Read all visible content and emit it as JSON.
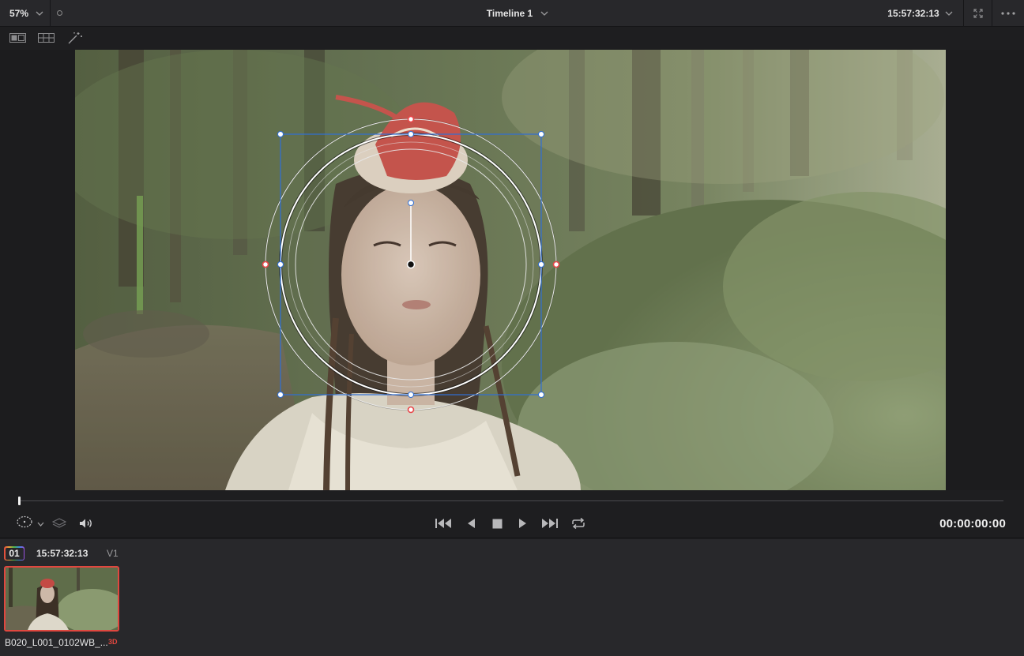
{
  "viewer": {
    "zoom": "57%",
    "timeline_name": "Timeline 1",
    "source_timecode": "15:57:32:13",
    "playhead_position": 0.0,
    "record_timecode": "00:00:00:00"
  },
  "icons": {
    "zoom_dropdown": "chevron-down-icon",
    "dot": "circle-dot-icon",
    "timeline_dropdown": "chevron-down-icon",
    "timecode_dropdown": "chevron-down-icon",
    "expand": "expand-icon",
    "more": "more-horizontal-icon",
    "single_viewer": "single-viewer-icon",
    "split_viewer": "split-screen-icon",
    "magic_wand": "magic-wand-icon",
    "window_tool": "circle-window-icon",
    "layers": "layers-icon",
    "audio": "speaker-icon",
    "first_frame": "skip-to-start-icon",
    "play_reverse": "play-reverse-icon",
    "stop": "stop-icon",
    "play": "play-icon",
    "last_frame": "skip-to-end-icon",
    "loop": "loop-icon"
  },
  "clips": [
    {
      "number": "01",
      "timecode": "15:57:32:13",
      "track": "V1",
      "name": "B020_L001_0102WB_...",
      "badge": "3D",
      "selected": true
    }
  ],
  "colors": {
    "window_box": "#2f6fd6",
    "handle_red": "#e8474a",
    "clip_selected_border": "#e0473f"
  }
}
